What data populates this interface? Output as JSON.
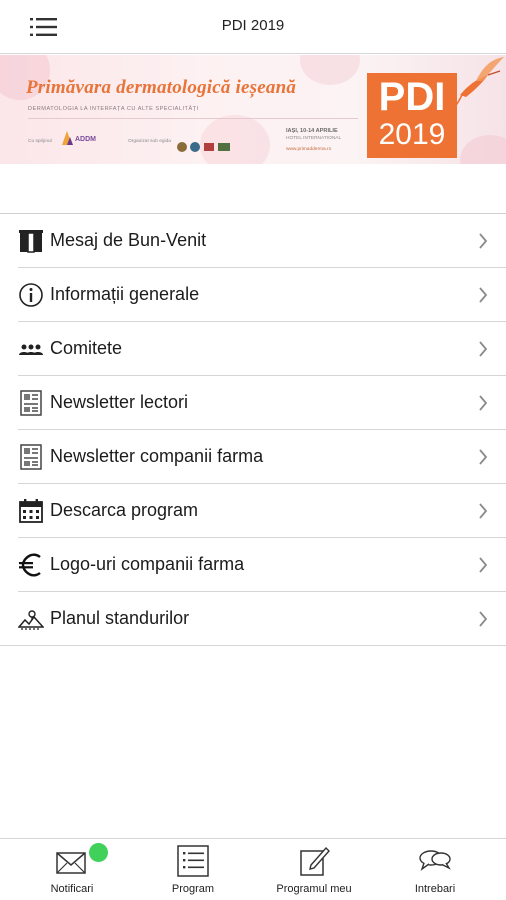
{
  "header": {
    "title": "PDI 2019",
    "menu_icon": "hamburger-menu-icon"
  },
  "banner": {
    "title": "Primăvara dermatologică ieșeană",
    "subtitle": "DERMATOLOGIA LA INTERFAȚA CU ALTE SPECIALITĂȚI",
    "organiser_label": "Cu sprijinul",
    "organiser_logo": "ADDM",
    "partner_label": "Organizat sub egida",
    "event_date": "IAȘI, 10-14 APRILIE",
    "event_venue": "HOTEL INTERNATIONAL",
    "event_url": "www.primadderma.ro",
    "badge_word": "PDI",
    "badge_year": "2019",
    "accent_color": "#ee7233"
  },
  "menu": {
    "items": [
      {
        "label": "Mesaj de Bun-Venit",
        "icon": "doors-icon"
      },
      {
        "label": "Informații generale",
        "icon": "info-icon"
      },
      {
        "label": "Comitete",
        "icon": "people-group-icon"
      },
      {
        "label": "Newsletter lectori",
        "icon": "newsletter-icon"
      },
      {
        "label": "Newsletter companii farma",
        "icon": "newsletter-icon"
      },
      {
        "label": "Descarca program",
        "icon": "calendar-icon"
      },
      {
        "label": "Logo-uri companii farma",
        "icon": "euro-icon"
      },
      {
        "label": "Planul standurilor",
        "icon": "map-icon"
      }
    ],
    "chevron_icon": "chevron-right-icon"
  },
  "tabbar": {
    "tabs": [
      {
        "label": "Notificari",
        "icon": "envelope-icon",
        "badge_color": "#3fd15a"
      },
      {
        "label": "Program",
        "icon": "list-icon"
      },
      {
        "label": "Programul meu",
        "icon": "edit-note-icon"
      },
      {
        "label": "Intrebari",
        "icon": "chat-bubbles-icon"
      }
    ]
  }
}
